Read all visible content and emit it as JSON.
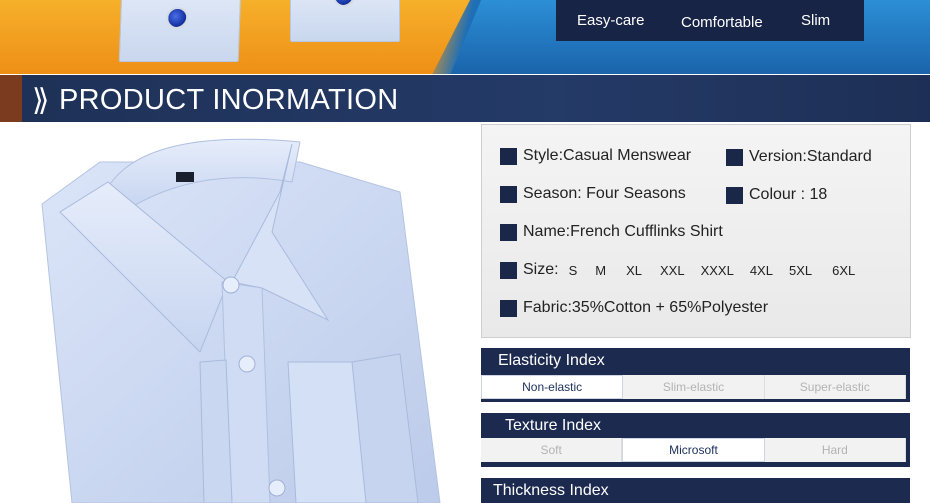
{
  "banner": {
    "features": [
      {
        "label": "Easy-care"
      },
      {
        "label": "Comfortable"
      },
      {
        "label": "Slim"
      }
    ]
  },
  "section": {
    "title": "PRODUCT INORMATION"
  },
  "info": {
    "style": "Style:Casual Menswear",
    "version": "Version:Standard",
    "season": "Season: Four Seasons",
    "colour": "Colour : 18",
    "name": "Name:French Cufflinks Shirt",
    "size_label": "Size:",
    "sizes": [
      "S",
      "M",
      "XL",
      "XXL",
      "XXXL",
      "4XL",
      "5XL",
      "6XL"
    ],
    "fabric": "Fabric:35%Cotton + 65%Polyester"
  },
  "elasticity": {
    "title": "Elasticity Index",
    "options": [
      "Non-elastic",
      "Slim-elastic",
      "Super-elastic"
    ],
    "active": "Non-elastic"
  },
  "texture": {
    "title": "Texture Index",
    "options": [
      "Soft",
      "Microsoft",
      "Hard"
    ],
    "active": "Microsoft"
  },
  "thickness": {
    "title": "Thickness Index"
  },
  "colors": {
    "navy": "#1b2a4e",
    "orange": "#f39a1a",
    "blue": "#2c8fd6",
    "shirt": "#c8d6f0"
  }
}
